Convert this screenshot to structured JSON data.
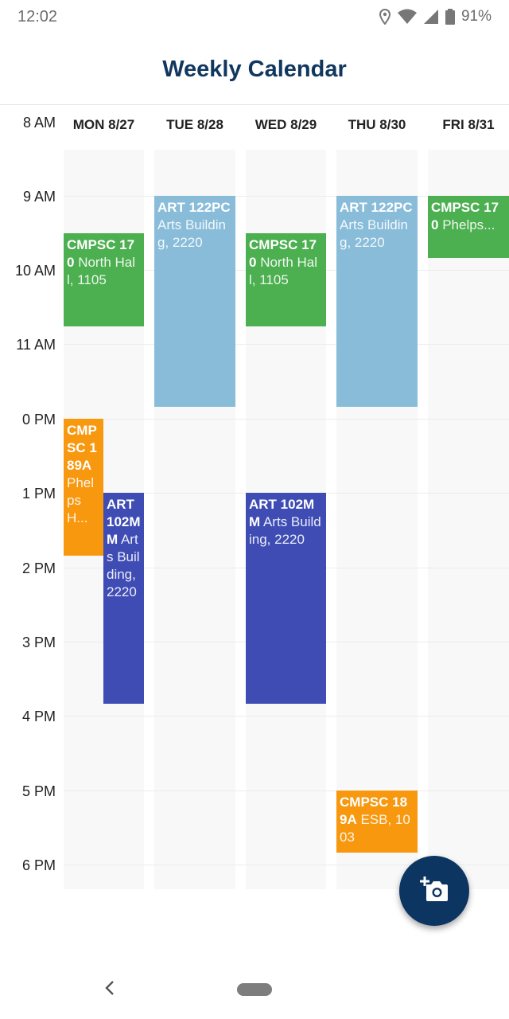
{
  "status_bar": {
    "time": "12:02",
    "battery_percent": "91%",
    "icons": [
      "location-icon",
      "wifi-icon",
      "signal-icon",
      "battery-icon"
    ]
  },
  "header": {
    "title": "Weekly Calendar"
  },
  "calendar": {
    "days": [
      "MON 8/27",
      "TUE 8/28",
      "WED 8/29",
      "THU 8/30",
      "FRI 8/31"
    ],
    "time_labels": [
      "8 AM",
      "9 AM",
      "10 AM",
      "11 AM",
      "0 PM",
      "1 PM",
      "2 PM",
      "3 PM",
      "4 PM",
      "5 PM",
      "6 PM"
    ],
    "events": [
      {
        "day": "MON 8/27",
        "code": "CMPSC 170",
        "location": "North Hall, 1105",
        "color": "#4caf50"
      },
      {
        "day": "MON 8/27",
        "code": "CMPSC 189A",
        "location": "Phelps H...",
        "color": "#f7980f"
      },
      {
        "day": "MON 8/27",
        "code": "ART 102MM",
        "location": "Arts Building, 2220",
        "color": "#3e4cb4"
      },
      {
        "day": "TUE 8/28",
        "code": "ART 122PC",
        "location": "Arts Building, 2220",
        "color": "#88bcd9"
      },
      {
        "day": "WED 8/29",
        "code": "CMPSC 170",
        "location": "North Hall, 1105",
        "color": "#4caf50"
      },
      {
        "day": "WED 8/29",
        "code": "ART 102MM",
        "location": "Arts Building, 2220",
        "color": "#3e4cb4"
      },
      {
        "day": "THU 8/30",
        "code": "ART 122PC",
        "location": "Arts Building, 2220",
        "color": "#88bcd9"
      },
      {
        "day": "THU 8/30",
        "code": "CMPSC 189A",
        "location": "ESB, 1003",
        "color": "#f7980f"
      },
      {
        "day": "FRI 8/31",
        "code": "CMPSC 170",
        "location": "Phelps...",
        "color": "#4caf50"
      }
    ]
  },
  "fab": {
    "icon": "add-photo-camera-icon"
  },
  "nav": {
    "icons": [
      "back-icon",
      "home-pill-icon"
    ]
  }
}
